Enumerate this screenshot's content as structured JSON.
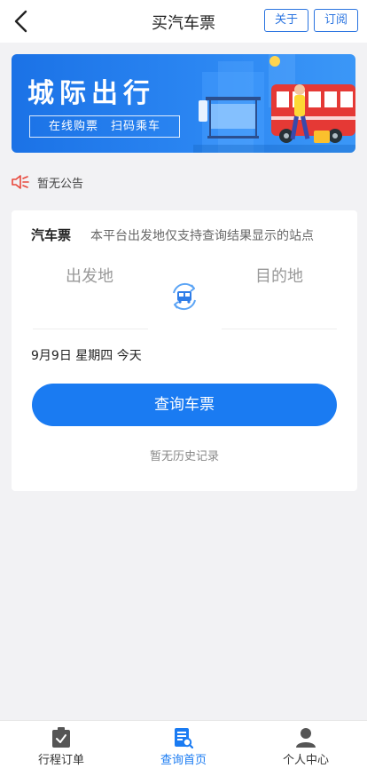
{
  "header": {
    "title": "买汽车票",
    "about_label": "关于",
    "subscribe_label": "订阅"
  },
  "banner": {
    "title": "城际出行",
    "subtitle": "在线购票　扫码乘车",
    "colors": {
      "background": "#1b72e6",
      "bus": "#e53935"
    }
  },
  "notice": {
    "text": "暂无公告",
    "icon": "speaker-icon",
    "color": "#e8473b"
  },
  "search": {
    "ticket_type": "汽车票",
    "note": "本平台出发地仅支持查询结果显示的站点",
    "from_placeholder": "出发地",
    "to_placeholder": "目的地",
    "date": "9月9日 星期四 今天",
    "submit_label": "查询车票",
    "history": "暂无历史记录",
    "accent": "#1a7bf2"
  },
  "tabs": [
    {
      "label": "行程订单",
      "icon": "clipboard-check-icon",
      "active": false
    },
    {
      "label": "查询首页",
      "icon": "document-search-icon",
      "active": true
    },
    {
      "label": "个人中心",
      "icon": "user-icon",
      "active": false
    }
  ]
}
